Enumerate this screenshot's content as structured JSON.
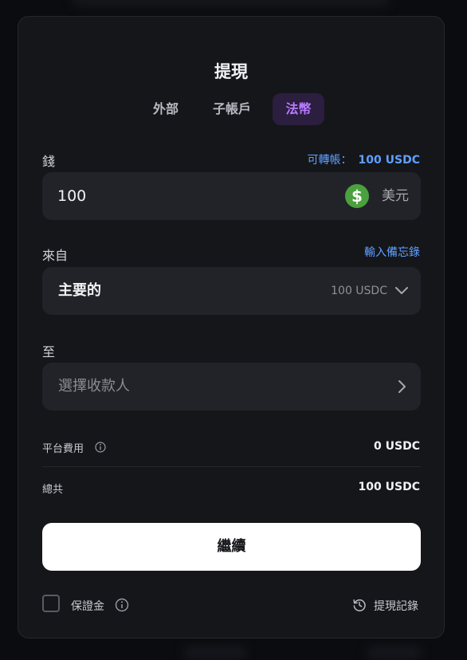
{
  "modal": {
    "title": "提現"
  },
  "tabs": [
    {
      "label": "外部",
      "active": false
    },
    {
      "label": "子帳戶",
      "active": false
    },
    {
      "label": "法幣",
      "active": true
    }
  ],
  "amount": {
    "label": "錢",
    "available_label": "可轉帳：",
    "available_value": "100 USDC",
    "value": "100",
    "currency_symbol": "$",
    "currency": "美元"
  },
  "from": {
    "label": "來自",
    "memo_link": "輸入備忘錄",
    "account": "主要的",
    "balance": "100 USDC"
  },
  "to": {
    "label": "至",
    "placeholder": "選擇收款人"
  },
  "summary": {
    "fee_label": "平台費用",
    "fee_value": "0 USDC",
    "total_label": "總共",
    "total_value": "100 USDC"
  },
  "continue_label": "繼續",
  "footer": {
    "margin_label": "保證金",
    "history_label": "提現記錄"
  },
  "colors": {
    "accent_purple": "#b77bff",
    "link_blue": "#5fa0ff",
    "coin_green": "#4aa13d"
  }
}
